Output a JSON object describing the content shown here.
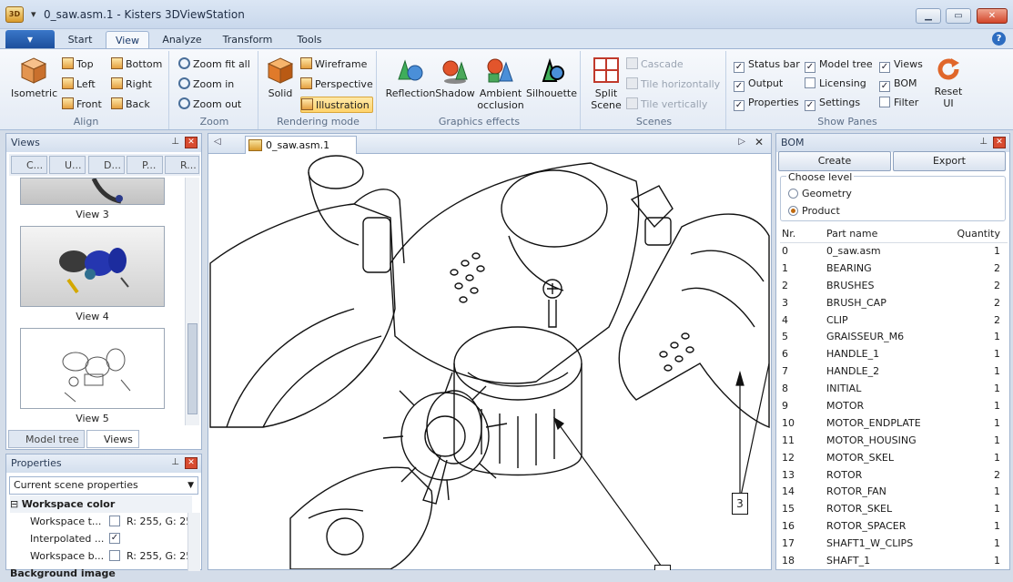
{
  "window": {
    "title": "0_saw.asm.1 - Kisters 3DViewStation",
    "app_icon_text": "3D"
  },
  "colors": {
    "accent": "#2d6cc0",
    "ribbon_bg": "#e8eef7",
    "highlight": "#ffd36b"
  },
  "ribbon": {
    "tabs": [
      "Start",
      "View",
      "Analyze",
      "Transform",
      "Tools"
    ],
    "active_tab": "View",
    "align": {
      "label": "Align",
      "isometric": "Isometric",
      "top": "Top",
      "left": "Left",
      "front": "Front",
      "bottom": "Bottom",
      "right": "Right",
      "back": "Back"
    },
    "zoom": {
      "label": "Zoom",
      "fit_all": "Zoom fit all",
      "in": "Zoom in",
      "out": "Zoom out"
    },
    "rendering": {
      "label": "Rendering mode",
      "solid": "Solid",
      "wireframe": "Wireframe",
      "perspective": "Perspective",
      "illustration": "Illustration"
    },
    "effects": {
      "label": "Graphics effects",
      "reflection": "Reflection",
      "shadow": "Shadow",
      "ambient": "Ambient occlusion",
      "silhouette": "Silhouette"
    },
    "scenes": {
      "label": "Scenes",
      "split": "Split Scene",
      "cascade": "Cascade",
      "tile_h": "Tile horizontally",
      "tile_v": "Tile vertically"
    },
    "panes": {
      "label": "Show Panes",
      "status_bar": "Status bar",
      "output": "Output",
      "properties": "Properties",
      "model_tree": "Model tree",
      "licensing": "Licensing",
      "settings": "Settings",
      "views": "Views",
      "bom": "BOM",
      "filter": "Filter",
      "reset": "Reset UI"
    }
  },
  "views_panel": {
    "title": "Views",
    "toolbar": [
      "C...",
      "U...",
      "D...",
      "P...",
      "R..."
    ],
    "items": [
      "View 3",
      "View 4",
      "View 5"
    ],
    "bottom_tabs": [
      "Model tree",
      "Views"
    ]
  },
  "properties_panel": {
    "title": "Properties",
    "dropdown": "Current scene properties",
    "section": "Workspace color",
    "rows": [
      {
        "name": "Workspace t...",
        "value": "R: 255, G: 25..."
      },
      {
        "name": "Interpolated ...",
        "value": "✓"
      },
      {
        "name": "Workspace b...",
        "value": "R: 255, G: 25..."
      }
    ],
    "next_section": "Background image"
  },
  "document": {
    "tab": "0_saw.asm.1",
    "callouts": [
      "3"
    ]
  },
  "bom": {
    "title": "BOM",
    "create": "Create",
    "export": "Export",
    "choose_level": "Choose level",
    "level_geometry": "Geometry",
    "level_product": "Product",
    "columns": [
      "Nr.",
      "Part name",
      "Quantity"
    ],
    "rows": [
      [
        "0",
        "0_saw.asm",
        "1"
      ],
      [
        "1",
        "BEARING",
        "2"
      ],
      [
        "2",
        "BRUSHES",
        "2"
      ],
      [
        "3",
        "BRUSH_CAP",
        "2"
      ],
      [
        "4",
        "CLIP",
        "2"
      ],
      [
        "5",
        "GRAISSEUR_M6",
        "1"
      ],
      [
        "6",
        "HANDLE_1",
        "1"
      ],
      [
        "7",
        "HANDLE_2",
        "1"
      ],
      [
        "8",
        "INITIAL",
        "1"
      ],
      [
        "9",
        "MOTOR",
        "1"
      ],
      [
        "10",
        "MOTOR_ENDPLATE",
        "1"
      ],
      [
        "11",
        "MOTOR_HOUSING",
        "1"
      ],
      [
        "12",
        "MOTOR_SKEL",
        "1"
      ],
      [
        "13",
        "ROTOR",
        "2"
      ],
      [
        "14",
        "ROTOR_FAN",
        "1"
      ],
      [
        "15",
        "ROTOR_SKEL",
        "1"
      ],
      [
        "16",
        "ROTOR_SPACER",
        "1"
      ],
      [
        "17",
        "SHAFT1_W_CLIPS",
        "1"
      ],
      [
        "18",
        "SHAFT_1",
        "1"
      ]
    ]
  }
}
